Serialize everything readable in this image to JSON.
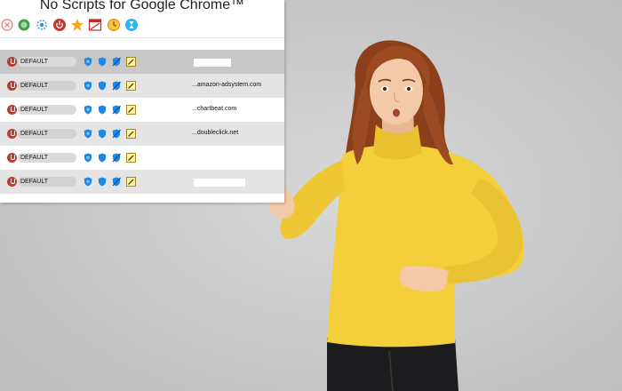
{
  "panel": {
    "title": "No Scripts for Google Chrome™",
    "toolbar": [
      {
        "icon": "close-circle-icon",
        "color": "#e57373"
      },
      {
        "icon": "green-circle-icon",
        "color": "#43a047"
      },
      {
        "icon": "settings-gear-icon",
        "color": "#2196f3"
      },
      {
        "icon": "power-icon",
        "color": "#c0392b"
      },
      {
        "icon": "star-icon",
        "color": "#f5a623"
      },
      {
        "icon": "calendar-block-icon",
        "color": "#c62828"
      },
      {
        "icon": "clock-icon",
        "color": "#f39c12"
      },
      {
        "icon": "hourglass-icon",
        "color": "#29b6f6"
      }
    ],
    "rows": [
      {
        "policy": "DEFAULT",
        "domain": "",
        "selected": true
      },
      {
        "policy": "DEFAULT",
        "domain": "...amazon-adsystem.com"
      },
      {
        "policy": "DEFAULT",
        "domain": "...chartbeat.com"
      },
      {
        "policy": "DEFAULT",
        "domain": "...doubleclick.net"
      },
      {
        "policy": "DEFAULT",
        "domain": ""
      },
      {
        "policy": "DEFAULT",
        "domain": ""
      }
    ]
  },
  "colors": {
    "sweater": "#f2cf3b",
    "hair": "#9b4a21",
    "skin": "#f3c9a8",
    "jeans": "#1c1c1f",
    "background": "#cfcfcf"
  }
}
